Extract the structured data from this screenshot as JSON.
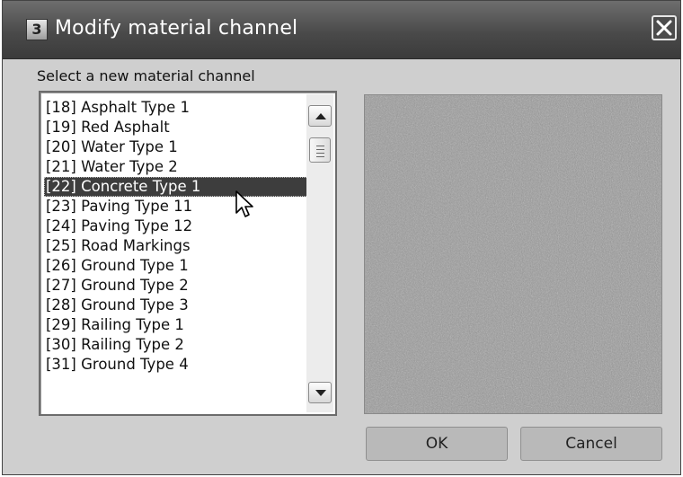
{
  "dialog": {
    "title": "Modify material channel",
    "app_icon_text": "3",
    "prompt": "Select a new material channel"
  },
  "list": {
    "items": [
      "[18] Asphalt Type 1",
      "[19] Red Asphalt",
      "[20] Water Type 1",
      "[21] Water Type 2",
      "[22] Concrete Type 1",
      "[23] Paving Type 11",
      "[24] Paving Type 12",
      "[25] Road Markings",
      "[26] Ground Type 1",
      "[27] Ground Type 2",
      "[28] Ground Type 3",
      "[29] Railing Type 1",
      "[30] Railing Type 2",
      "[31] Ground Type 4"
    ],
    "selected_index": 4
  },
  "buttons": {
    "ok": "OK",
    "cancel": "Cancel"
  },
  "colors": {
    "selection": "#3d3d3d",
    "dialog_bg": "#cfcfcf",
    "titlebar": "#4a4a4a"
  }
}
